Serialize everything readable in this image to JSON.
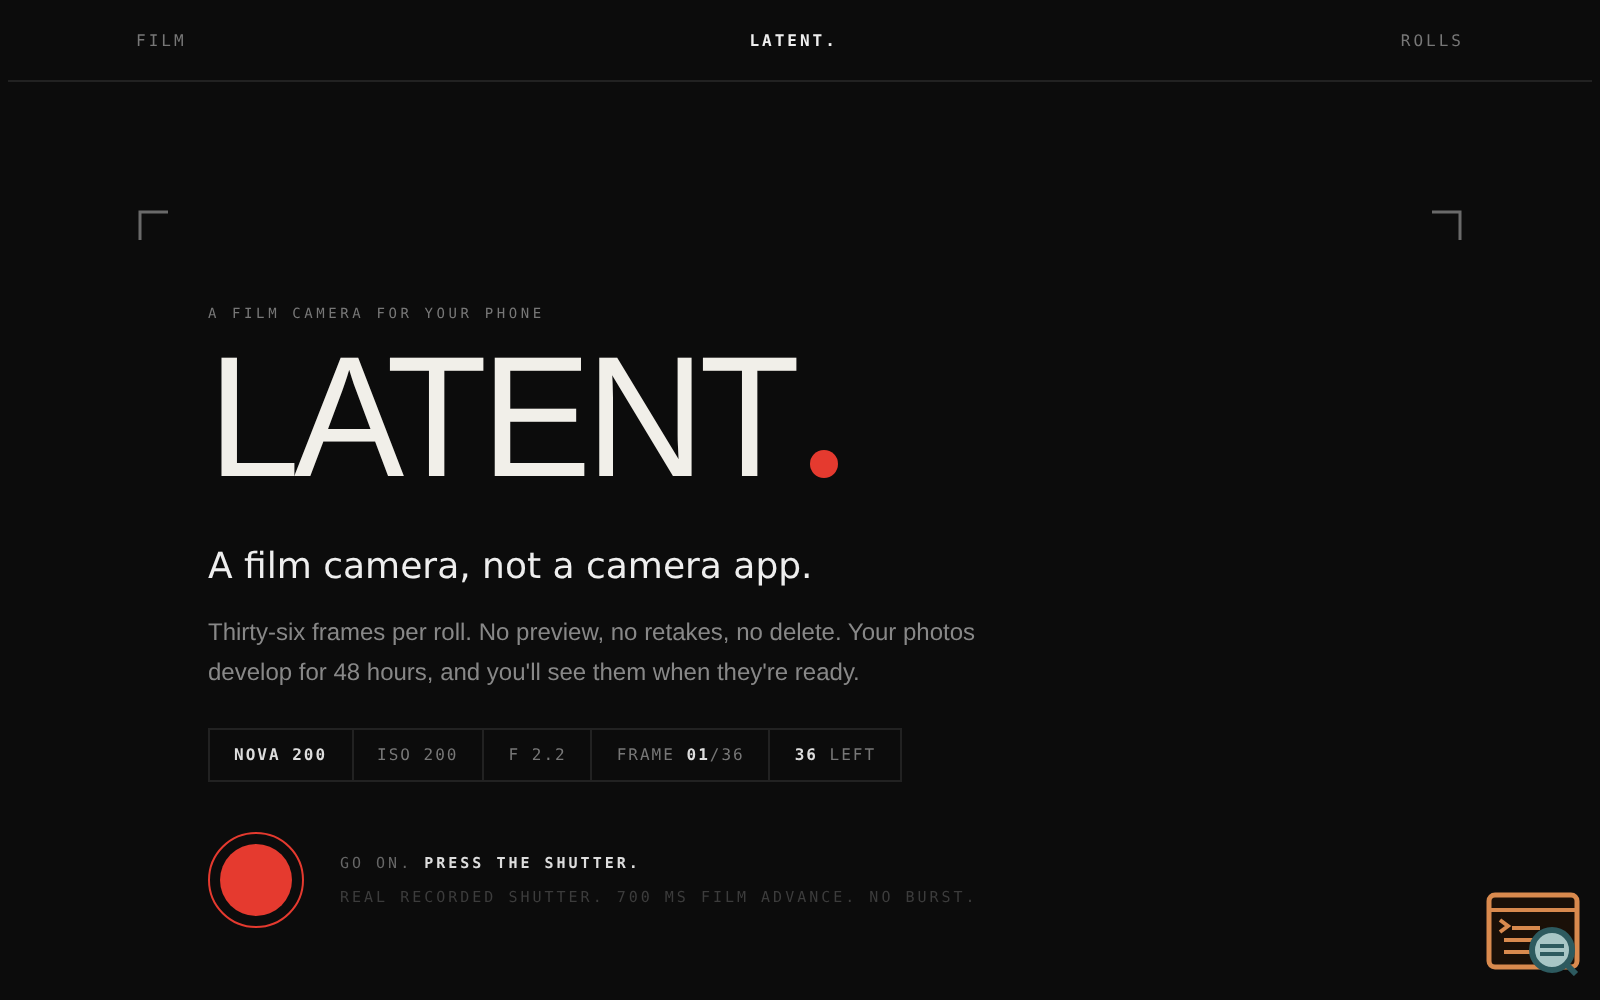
{
  "nav": {
    "left": "FILM",
    "brand": "LATENT.",
    "right": "ROLLS"
  },
  "hero": {
    "eyebrow": "A FILM CAMERA FOR YOUR PHONE",
    "title": "LATENT",
    "tagline": "A film camera, not a camera app.",
    "description": "Thirty-six frames per roll. No preview, no retakes, no delete. Your photos develop for 48 hours, and you'll see them when they're ready."
  },
  "specs": [
    {
      "text": "NOVA 200",
      "emphasis": true
    },
    {
      "text": "ISO 200",
      "emphasis": false
    },
    {
      "text": "F 2.2",
      "emphasis": false
    },
    {
      "text": "FRAME **01**/36",
      "emphasis": false
    },
    {
      "text": "**36** LEFT",
      "emphasis": false
    }
  ],
  "shutter": {
    "prompt": "GO ON. **PRESS THE SHUTTER.**",
    "note": "REAL RECORDED SHUTTER. 700 MS FILM ADVANCE. NO BURST."
  }
}
